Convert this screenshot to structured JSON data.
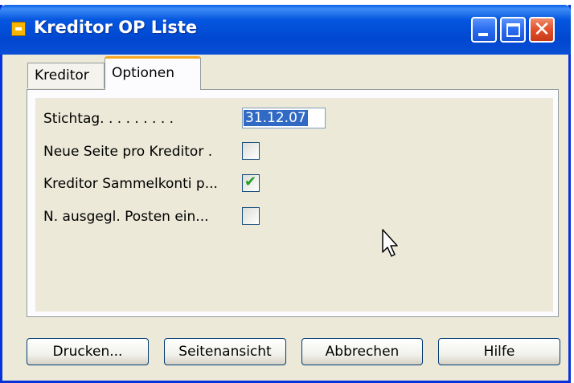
{
  "window": {
    "title": "Kreditor OP Liste"
  },
  "tabs": [
    {
      "label": "Kreditor",
      "active": false
    },
    {
      "label": "Optionen",
      "active": true
    }
  ],
  "options": {
    "stichtag": {
      "label": "Stichtag. . . . . . . . .",
      "value": "31.12.07"
    },
    "neue_seite": {
      "label": "Neue Seite pro Kreditor  .",
      "checked": false
    },
    "sammelkonti": {
      "label": "Kreditor Sammelkonti p...",
      "checked": true
    },
    "ausgegl_posten": {
      "label": "N. ausgegl. Posten ein...",
      "checked": false
    }
  },
  "buttons": {
    "drucken": "Drucken...",
    "seitenansicht": "Seitenansicht",
    "abbrechen": "Abbrechen",
    "hilfe": "Hilfe"
  },
  "colors": {
    "titlebar": "#0054e3",
    "dialog_bg": "#ece9d8",
    "tab_accent": "#f5a623",
    "selection": "#316ac5",
    "check": "#21a121"
  }
}
